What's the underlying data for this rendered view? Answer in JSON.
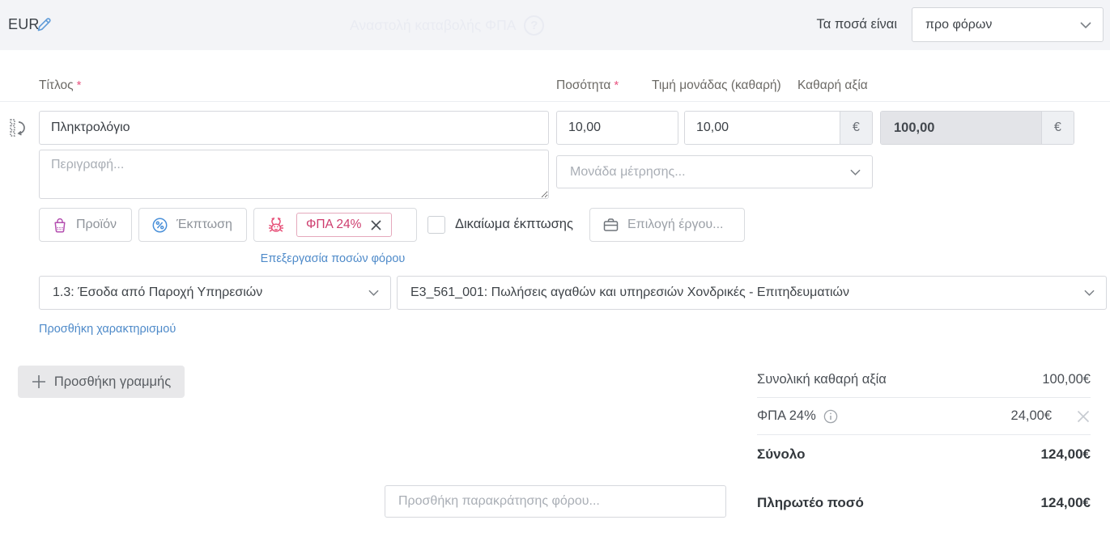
{
  "topbar": {
    "currency": "EUR",
    "ghost_label": "Αναστολή καταβολής ΦΠΑ",
    "amounts_are_label": "Τα ποσά είναι",
    "amounts_mode_selected": "προ φόρων"
  },
  "line_item": {
    "headers": {
      "title": "Τίτλος",
      "quantity": "Ποσότητα",
      "unit_price": "Τιμή μονάδας (καθαρή)",
      "net_value": "Καθαρή αξία"
    },
    "required_marker": "*",
    "title_value": "Πληκτρολόγιο",
    "description_placeholder": "Περιγραφή...",
    "quantity_value": "10,00",
    "unit_price_value": "10,00",
    "currency_symbol": "€",
    "net_value": "100,00",
    "unit_placeholder": "Μονάδα μέτρησης...",
    "product_button": "Προϊόν",
    "discount_button": "Έκπτωση",
    "vat_chip": "ΦΠΑ 24%",
    "deduction_checkbox_label": "Δικαίωμα έκπτωσης",
    "project_button": "Επιλογή έργου...",
    "edit_tax_link": "Επεξεργασία ποσών φόρου",
    "income_category": "1.3: Έσοδα από Παροχή Υπηρεσιών",
    "e3_classification": "Ε3_561_001: Πωλήσεις αγαθών και υπηρεσιών Χονδρικές - Επιτηδευματιών",
    "add_characterization_link": "Προσθήκη χαρακτηρισμού"
  },
  "footer": {
    "add_line_label": "Προσθήκη γραμμής",
    "withholding_placeholder": "Προσθήκη παρακράτησης φόρου...",
    "totals": [
      {
        "label": "Συνολική καθαρή αξία",
        "value": "100,00€"
      },
      {
        "label": "ΦΠΑ 24%",
        "value": "24,00€"
      },
      {
        "label": "Σύνολο",
        "value": "124,00€"
      },
      {
        "label": "Πληρωτέο ποσό",
        "value": "124,00€"
      }
    ]
  },
  "icons": {
    "question_glyph": "?",
    "names": [
      "edit-pencil-icon",
      "question-circle-icon",
      "chevron-down-icon",
      "drag-reorder-icon",
      "shopping-bag-icon",
      "percent-badge-icon",
      "tax-crab-icon",
      "close-icon",
      "briefcase-icon",
      "info-circle-icon",
      "plus-icon",
      "resize-handle"
    ]
  },
  "colors": {
    "topbar_bg": "#f3f4f7",
    "link_blue": "#4e8ac9",
    "accent_pink": "#ce3d6e",
    "product_purple": "#b44fb0",
    "discount_blue": "#4a90d9",
    "readonly_bg": "#e3e4e8",
    "suffix_bg": "#eef0f3",
    "required_red": "#e85481"
  }
}
